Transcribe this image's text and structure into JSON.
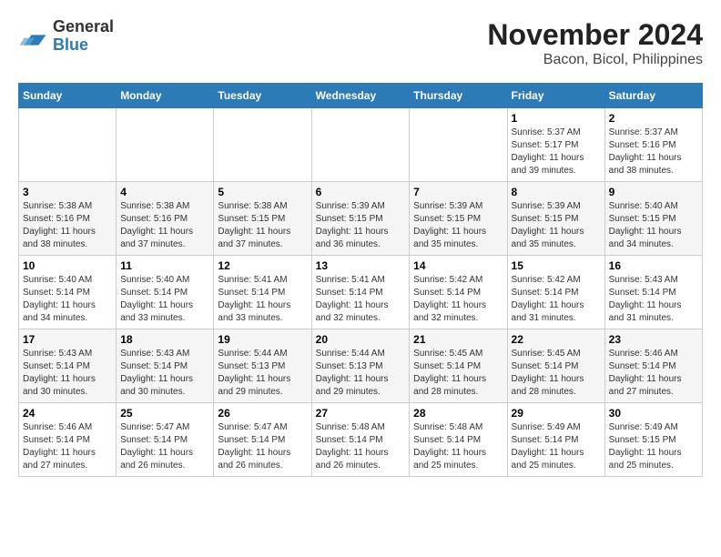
{
  "header": {
    "logo_line1": "General",
    "logo_line2": "Blue",
    "month": "November 2024",
    "location": "Bacon, Bicol, Philippines"
  },
  "days_of_week": [
    "Sunday",
    "Monday",
    "Tuesday",
    "Wednesday",
    "Thursday",
    "Friday",
    "Saturday"
  ],
  "weeks": [
    [
      {
        "day": "",
        "info": ""
      },
      {
        "day": "",
        "info": ""
      },
      {
        "day": "",
        "info": ""
      },
      {
        "day": "",
        "info": ""
      },
      {
        "day": "",
        "info": ""
      },
      {
        "day": "1",
        "info": "Sunrise: 5:37 AM\nSunset: 5:17 PM\nDaylight: 11 hours and 39 minutes."
      },
      {
        "day": "2",
        "info": "Sunrise: 5:37 AM\nSunset: 5:16 PM\nDaylight: 11 hours and 38 minutes."
      }
    ],
    [
      {
        "day": "3",
        "info": "Sunrise: 5:38 AM\nSunset: 5:16 PM\nDaylight: 11 hours and 38 minutes."
      },
      {
        "day": "4",
        "info": "Sunrise: 5:38 AM\nSunset: 5:16 PM\nDaylight: 11 hours and 37 minutes."
      },
      {
        "day": "5",
        "info": "Sunrise: 5:38 AM\nSunset: 5:15 PM\nDaylight: 11 hours and 37 minutes."
      },
      {
        "day": "6",
        "info": "Sunrise: 5:39 AM\nSunset: 5:15 PM\nDaylight: 11 hours and 36 minutes."
      },
      {
        "day": "7",
        "info": "Sunrise: 5:39 AM\nSunset: 5:15 PM\nDaylight: 11 hours and 35 minutes."
      },
      {
        "day": "8",
        "info": "Sunrise: 5:39 AM\nSunset: 5:15 PM\nDaylight: 11 hours and 35 minutes."
      },
      {
        "day": "9",
        "info": "Sunrise: 5:40 AM\nSunset: 5:15 PM\nDaylight: 11 hours and 34 minutes."
      }
    ],
    [
      {
        "day": "10",
        "info": "Sunrise: 5:40 AM\nSunset: 5:14 PM\nDaylight: 11 hours and 34 minutes."
      },
      {
        "day": "11",
        "info": "Sunrise: 5:40 AM\nSunset: 5:14 PM\nDaylight: 11 hours and 33 minutes."
      },
      {
        "day": "12",
        "info": "Sunrise: 5:41 AM\nSunset: 5:14 PM\nDaylight: 11 hours and 33 minutes."
      },
      {
        "day": "13",
        "info": "Sunrise: 5:41 AM\nSunset: 5:14 PM\nDaylight: 11 hours and 32 minutes."
      },
      {
        "day": "14",
        "info": "Sunrise: 5:42 AM\nSunset: 5:14 PM\nDaylight: 11 hours and 32 minutes."
      },
      {
        "day": "15",
        "info": "Sunrise: 5:42 AM\nSunset: 5:14 PM\nDaylight: 11 hours and 31 minutes."
      },
      {
        "day": "16",
        "info": "Sunrise: 5:43 AM\nSunset: 5:14 PM\nDaylight: 11 hours and 31 minutes."
      }
    ],
    [
      {
        "day": "17",
        "info": "Sunrise: 5:43 AM\nSunset: 5:14 PM\nDaylight: 11 hours and 30 minutes."
      },
      {
        "day": "18",
        "info": "Sunrise: 5:43 AM\nSunset: 5:14 PM\nDaylight: 11 hours and 30 minutes."
      },
      {
        "day": "19",
        "info": "Sunrise: 5:44 AM\nSunset: 5:13 PM\nDaylight: 11 hours and 29 minutes."
      },
      {
        "day": "20",
        "info": "Sunrise: 5:44 AM\nSunset: 5:13 PM\nDaylight: 11 hours and 29 minutes."
      },
      {
        "day": "21",
        "info": "Sunrise: 5:45 AM\nSunset: 5:14 PM\nDaylight: 11 hours and 28 minutes."
      },
      {
        "day": "22",
        "info": "Sunrise: 5:45 AM\nSunset: 5:14 PM\nDaylight: 11 hours and 28 minutes."
      },
      {
        "day": "23",
        "info": "Sunrise: 5:46 AM\nSunset: 5:14 PM\nDaylight: 11 hours and 27 minutes."
      }
    ],
    [
      {
        "day": "24",
        "info": "Sunrise: 5:46 AM\nSunset: 5:14 PM\nDaylight: 11 hours and 27 minutes."
      },
      {
        "day": "25",
        "info": "Sunrise: 5:47 AM\nSunset: 5:14 PM\nDaylight: 11 hours and 26 minutes."
      },
      {
        "day": "26",
        "info": "Sunrise: 5:47 AM\nSunset: 5:14 PM\nDaylight: 11 hours and 26 minutes."
      },
      {
        "day": "27",
        "info": "Sunrise: 5:48 AM\nSunset: 5:14 PM\nDaylight: 11 hours and 26 minutes."
      },
      {
        "day": "28",
        "info": "Sunrise: 5:48 AM\nSunset: 5:14 PM\nDaylight: 11 hours and 25 minutes."
      },
      {
        "day": "29",
        "info": "Sunrise: 5:49 AM\nSunset: 5:14 PM\nDaylight: 11 hours and 25 minutes."
      },
      {
        "day": "30",
        "info": "Sunrise: 5:49 AM\nSunset: 5:15 PM\nDaylight: 11 hours and 25 minutes."
      }
    ]
  ]
}
